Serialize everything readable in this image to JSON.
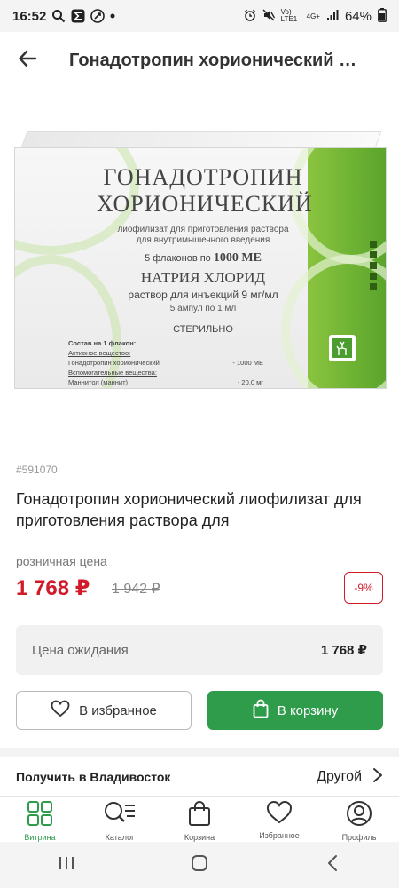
{
  "status_bar": {
    "time": "16:52",
    "network": "Vo) LTE1",
    "net_type": "4G+",
    "battery": "64%"
  },
  "header": {
    "title": "Гонадотропин хорионический лиофилизат для приготовления раствора для"
  },
  "packaging": {
    "name_line1": "ГОНАДОТРОПИН",
    "name_line2": "ХОРИОНИЧЕСКИЙ",
    "desc1": "лиофилизат для приготовления раствора",
    "desc2": "для внутримышечного введения",
    "dose_prefix": "5 флаконов по",
    "dose_value": "1000 МЕ",
    "solvent_name": "НАТРИЯ ХЛОРИД",
    "solvent_desc": "раствор для инъекций  9 мг/мл",
    "ampoules": "5 ампул по 1 мл",
    "sterile": "СТЕРИЛЬНО",
    "comp_title": "Состав на 1 флакон:",
    "comp_active": "Активное вещество:",
    "comp_active_name": "Гонадотропин хорионический",
    "comp_active_value": "- 1000 МЕ",
    "comp_aux": "Вспомогательные вещества:",
    "comp_aux_name": "Маннитол (маннит)",
    "comp_aux_value": "- 20,0 мг"
  },
  "product": {
    "sku": "#591070",
    "title": "Гонадотропин хорионический лиофилизат для приготовления раствора для",
    "price_label": "розничная цена",
    "price_current": "1 768 ₽",
    "price_old": "1 942 ₽",
    "discount": "-9%"
  },
  "wait_price": {
    "label": "Цена ожидания",
    "value": "1 768 ₽"
  },
  "actions": {
    "favorite_label": "В избранное",
    "cart_label": "В корзину"
  },
  "delivery": {
    "label": "Получить в Владивосток",
    "other_label": "Другой"
  },
  "bottom_nav": {
    "items": [
      {
        "label": "Витрина",
        "icon": "grid-icon"
      },
      {
        "label": "Каталог",
        "icon": "catalog-search-icon"
      },
      {
        "label": "Корзина",
        "icon": "bag-icon"
      },
      {
        "label": "Избранное",
        "icon": "heart-icon"
      },
      {
        "label": "Профиль",
        "icon": "profile-icon"
      }
    ]
  },
  "colors": {
    "accent_green": "#2e9c4a",
    "price_red": "#d11a2a"
  }
}
